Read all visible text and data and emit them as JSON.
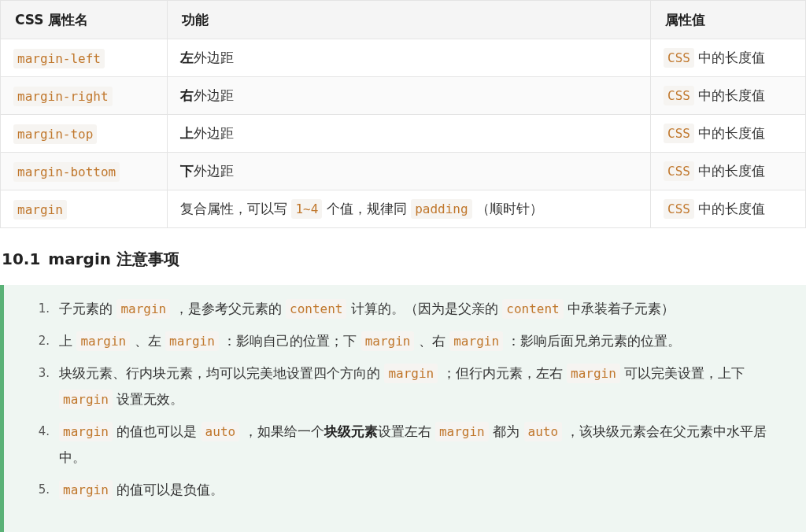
{
  "table": {
    "columns": [
      "CSS 属性名",
      "功能",
      "属性值"
    ],
    "rows": [
      {
        "cells": [
          [
            {
              "kind": "code",
              "text": "margin-left"
            }
          ],
          [
            {
              "kind": "bold",
              "text": "左"
            },
            {
              "kind": "text",
              "text": "外边距"
            }
          ],
          [
            {
              "kind": "code",
              "text": "CSS"
            },
            {
              "kind": "text",
              "text": " 中的长度值"
            }
          ]
        ]
      },
      {
        "cells": [
          [
            {
              "kind": "code",
              "text": "margin-right"
            }
          ],
          [
            {
              "kind": "bold",
              "text": "右"
            },
            {
              "kind": "text",
              "text": "外边距"
            }
          ],
          [
            {
              "kind": "code",
              "text": "CSS"
            },
            {
              "kind": "text",
              "text": " 中的长度值"
            }
          ]
        ]
      },
      {
        "cells": [
          [
            {
              "kind": "code",
              "text": "margin-top"
            }
          ],
          [
            {
              "kind": "bold",
              "text": "上"
            },
            {
              "kind": "text",
              "text": "外边距"
            }
          ],
          [
            {
              "kind": "code",
              "text": "CSS"
            },
            {
              "kind": "text",
              "text": " 中的长度值"
            }
          ]
        ]
      },
      {
        "cells": [
          [
            {
              "kind": "code",
              "text": "margin-bottom"
            }
          ],
          [
            {
              "kind": "bold",
              "text": "下"
            },
            {
              "kind": "text",
              "text": "外边距"
            }
          ],
          [
            {
              "kind": "code",
              "text": "CSS"
            },
            {
              "kind": "text",
              "text": " 中的长度值"
            }
          ]
        ]
      },
      {
        "cells": [
          [
            {
              "kind": "code",
              "text": "margin"
            }
          ],
          [
            {
              "kind": "text",
              "text": "复合属性，可以写 "
            },
            {
              "kind": "code",
              "text": "1~4"
            },
            {
              "kind": "text",
              "text": " 个值，规律同 "
            },
            {
              "kind": "code",
              "text": "padding"
            },
            {
              "kind": "text",
              "text": " （顺时针）"
            }
          ],
          [
            {
              "kind": "code",
              "text": "CSS"
            },
            {
              "kind": "text",
              "text": " 中的长度值"
            }
          ]
        ]
      }
    ]
  },
  "section": {
    "number": "10.1",
    "title": "margin 注意事项"
  },
  "notes": [
    {
      "marker": "1.",
      "segments": [
        {
          "kind": "text",
          "text": "子元素的 "
        },
        {
          "kind": "code",
          "text": "margin"
        },
        {
          "kind": "text",
          "text": " ，是参考父元素的 "
        },
        {
          "kind": "code",
          "text": "content"
        },
        {
          "kind": "text",
          "text": " 计算的。（因为是父亲的 "
        },
        {
          "kind": "code",
          "text": "content"
        },
        {
          "kind": "text",
          "text": " 中承装着子元素）"
        }
      ]
    },
    {
      "marker": "2.",
      "segments": [
        {
          "kind": "text",
          "text": "上 "
        },
        {
          "kind": "code",
          "text": "margin"
        },
        {
          "kind": "text",
          "text": " 、左 "
        },
        {
          "kind": "code",
          "text": "margin"
        },
        {
          "kind": "text",
          "text": " ：影响自己的位置；下 "
        },
        {
          "kind": "code",
          "text": "margin"
        },
        {
          "kind": "text",
          "text": " 、右 "
        },
        {
          "kind": "code",
          "text": "margin"
        },
        {
          "kind": "text",
          "text": " ：影响后面兄弟元素的位置。"
        }
      ]
    },
    {
      "marker": "3.",
      "segments": [
        {
          "kind": "text",
          "text": "块级元素、行内块元素，均可以完美地设置四个方向的 "
        },
        {
          "kind": "code",
          "text": "margin"
        },
        {
          "kind": "text",
          "text": " ；但行内元素，左右 "
        },
        {
          "kind": "code",
          "text": "margin"
        },
        {
          "kind": "text",
          "text": " 可以完美设置，上下 "
        },
        {
          "kind": "code",
          "text": "margin"
        },
        {
          "kind": "text",
          "text": " 设置无效。"
        }
      ]
    },
    {
      "marker": "4.",
      "segments": [
        {
          "kind": "code",
          "text": "margin"
        },
        {
          "kind": "text",
          "text": " 的值也可以是 "
        },
        {
          "kind": "code",
          "text": "auto"
        },
        {
          "kind": "text",
          "text": " ，如果给一个"
        },
        {
          "kind": "bold",
          "text": "块级元素"
        },
        {
          "kind": "text",
          "text": "设置左右 "
        },
        {
          "kind": "code",
          "text": "margin"
        },
        {
          "kind": "text",
          "text": " 都为 "
        },
        {
          "kind": "code",
          "text": "auto"
        },
        {
          "kind": "text",
          "text": " ，该块级元素会在父元素中水平居中。"
        }
      ]
    },
    {
      "marker": "5.",
      "segments": [
        {
          "kind": "code",
          "text": "margin"
        },
        {
          "kind": "text",
          "text": " 的值可以是负值。"
        }
      ]
    }
  ]
}
